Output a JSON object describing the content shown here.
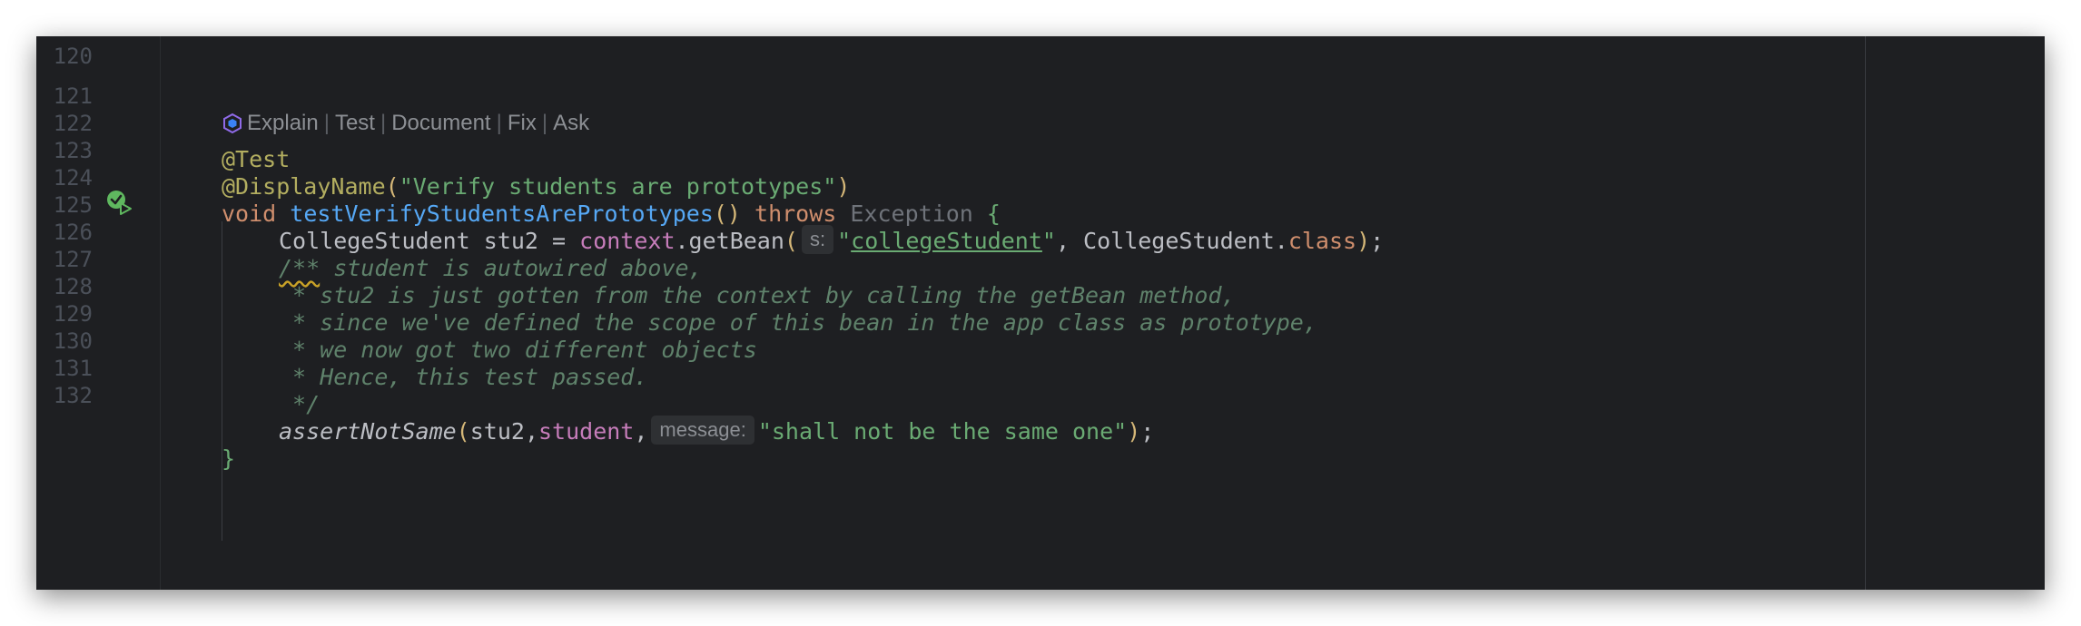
{
  "editor": {
    "line_numbers": [
      "120",
      "121",
      "122",
      "123",
      "124",
      "125",
      "126",
      "127",
      "128",
      "129",
      "130",
      "131",
      "132"
    ],
    "codevision": {
      "icon": "ai-assistant-icon",
      "items": [
        "Explain",
        "Test",
        "Document",
        "Fix",
        "Ask"
      ],
      "separator": "|"
    },
    "lines": {
      "l121": {
        "annotation": "@Test"
      },
      "l122": {
        "annotation": "@DisplayName",
        "open": "(",
        "string": "\"Verify students are prototypes\"",
        "close": ")"
      },
      "l123": {
        "void": "void ",
        "method": "testVerifyStudentsArePrototypes",
        "parens": "()",
        "throws": " throws ",
        "exception": "Exception",
        "brace": " {"
      },
      "l124": {
        "type_and_var": "CollegeStudent stu2 = ",
        "context": "context",
        "call": ".getBean",
        "open": "(",
        "hint": "s:",
        "quote_open": "\"",
        "bean_name": "collegeStudent",
        "quote_close": "\"",
        "comma_type": ", CollegeStudent.",
        "class_kw": "class",
        "close": ")",
        "semi": ";"
      },
      "l125": {
        "doc_start": "/**",
        "text": " student is autowired above,"
      },
      "l126": {
        "text": " * stu2 is just gotten from the context by calling the getBean method,"
      },
      "l127": {
        "text": " * since we've defined the scope of this bean in the app class as prototype,"
      },
      "l128": {
        "text": " * we now got two different objects"
      },
      "l129": {
        "text": " * Hence, this test passed."
      },
      "l130": {
        "text": " */"
      },
      "l131": {
        "call": "assertNotSame",
        "open": "(",
        "args": "stu2,",
        "field": "student",
        "comma": ",",
        "hint": "message:",
        "string": "\"shall not be the same one\"",
        "close": ")",
        "semi": ";"
      },
      "l132": {
        "brace": "}"
      }
    }
  },
  "colors": {
    "background": "#1e1f22",
    "annotation": "#b3ae60",
    "string": "#6aab73",
    "keyword": "#cf8e6d",
    "method_declaration": "#56a8f5",
    "field": "#c77dbb",
    "comment": "#5f826b",
    "line_number": "#4b5059",
    "run_icon": "#5fb85f"
  }
}
